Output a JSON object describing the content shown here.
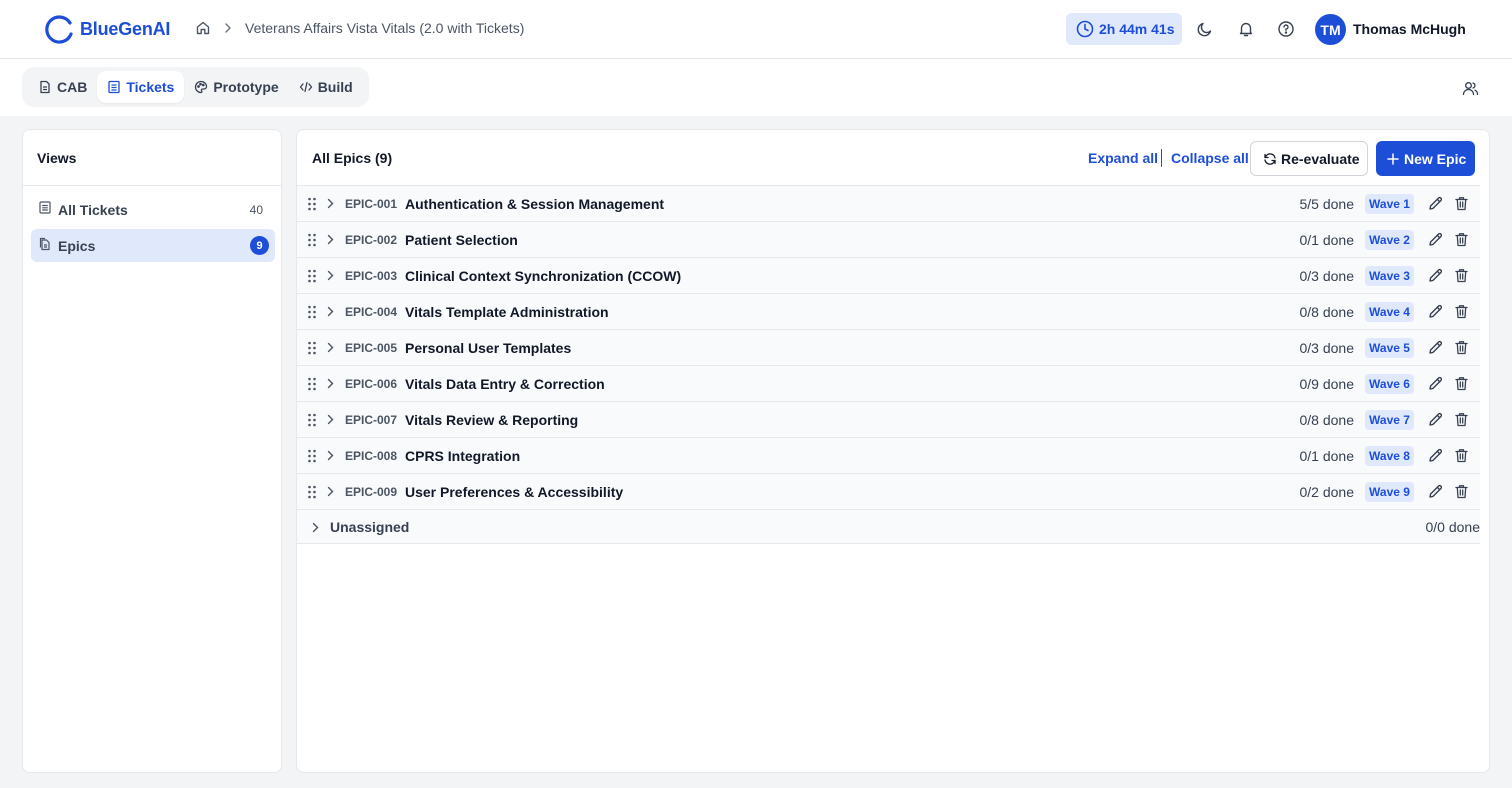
{
  "app": {
    "name": "BlueGenAI",
    "breadcrumb": "Veterans Affairs Vista Vitals (2.0 with Tickets)",
    "timer": "2h 44m 41s",
    "user_initials": "TM",
    "user_name": "Thomas McHugh",
    "accent": "#1d4ed8"
  },
  "tabs": [
    {
      "label": "CAB",
      "icon": "document-icon",
      "active": false
    },
    {
      "label": "Tickets",
      "icon": "list-icon",
      "active": true
    },
    {
      "label": "Prototype",
      "icon": "palette-icon",
      "active": false
    },
    {
      "label": "Build",
      "icon": "code-icon",
      "active": false
    }
  ],
  "sidebar": {
    "title": "Views",
    "items": [
      {
        "label": "All Tickets",
        "count": "40",
        "active": false
      },
      {
        "label": "Epics",
        "count": "9",
        "active": true
      }
    ]
  },
  "main": {
    "title": "All Epics (9)",
    "expand_all": "Expand all",
    "collapse_all": "Collapse all",
    "reevaluate": "Re-evaluate",
    "new_epic": "New Epic"
  },
  "epics": [
    {
      "id": "EPIC-001",
      "title": "Authentication & Session Management",
      "done": "5/5 done",
      "wave": "Wave 1"
    },
    {
      "id": "EPIC-002",
      "title": "Patient Selection",
      "done": "0/1 done",
      "wave": "Wave 2"
    },
    {
      "id": "EPIC-003",
      "title": "Clinical Context Synchronization (CCOW)",
      "done": "0/3 done",
      "wave": "Wave 3"
    },
    {
      "id": "EPIC-004",
      "title": "Vitals Template Administration",
      "done": "0/8 done",
      "wave": "Wave 4"
    },
    {
      "id": "EPIC-005",
      "title": "Personal User Templates",
      "done": "0/3 done",
      "wave": "Wave 5"
    },
    {
      "id": "EPIC-006",
      "title": "Vitals Data Entry & Correction",
      "done": "0/9 done",
      "wave": "Wave 6"
    },
    {
      "id": "EPIC-007",
      "title": "Vitals Review & Reporting",
      "done": "0/8 done",
      "wave": "Wave 7"
    },
    {
      "id": "EPIC-008",
      "title": "CPRS Integration",
      "done": "0/1 done",
      "wave": "Wave 8"
    },
    {
      "id": "EPIC-009",
      "title": "User Preferences & Accessibility",
      "done": "0/2 done",
      "wave": "Wave 9"
    }
  ],
  "unassigned": {
    "label": "Unassigned",
    "done": "0/0 done"
  }
}
